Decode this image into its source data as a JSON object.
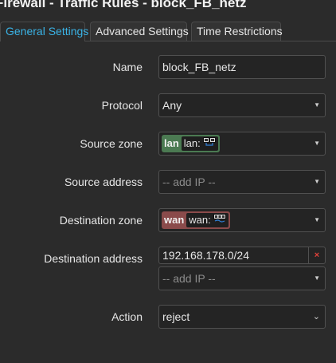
{
  "header": {
    "title": "Firewall - Traffic Rules - block_FB_netz"
  },
  "tabs": [
    {
      "label": "General Settings",
      "active": true
    },
    {
      "label": "Advanced Settings",
      "active": false
    },
    {
      "label": "Time Restrictions",
      "active": false
    }
  ],
  "form": {
    "name": {
      "label": "Name",
      "value": "block_FB_netz"
    },
    "protocol": {
      "label": "Protocol",
      "value": "Any"
    },
    "source_zone": {
      "label": "Source zone",
      "zone_name": "lan",
      "zone_label": "lan:",
      "zone_color": "#4b7a52",
      "icon": "network-ports-icon"
    },
    "source_address": {
      "label": "Source address",
      "placeholder": "-- add IP --"
    },
    "destination_zone": {
      "label": "Destination zone",
      "zone_name": "wan",
      "zone_label": "wan:",
      "zone_color": "#8a4b4b",
      "icon": "ethernet-port-icon"
    },
    "destination_address": {
      "label": "Destination address",
      "value": "192.168.178.0/24",
      "remove_label": "×",
      "placeholder": "-- add IP --"
    },
    "action": {
      "label": "Action",
      "value": "reject"
    }
  },
  "colors": {
    "accent": "#3ab3e6",
    "background": "#2b2b2b",
    "remove": "#e0413a"
  }
}
